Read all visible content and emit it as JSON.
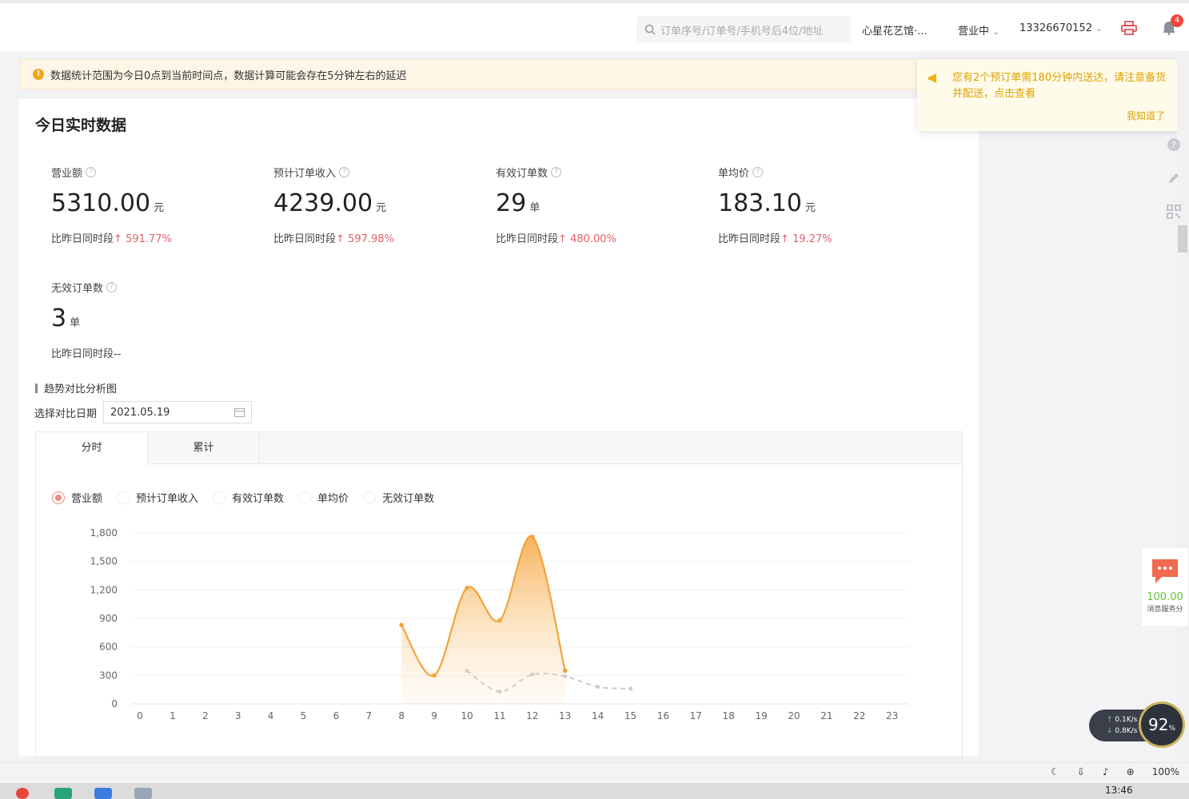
{
  "topbar": {
    "search_placeholder": "订单序号/订单号/手机号后4位/地址",
    "store_name": "心星花艺馆·...",
    "business_status": "营业中",
    "account": "13326670152",
    "notification_count": "4"
  },
  "notice": {
    "text": "数据统计范围为今日0点到当前时间点，数据计算可能会存在5分钟左右的延迟"
  },
  "popup": {
    "message": "您有2个预订单需180分钟内送达，请注意备货并配送，点击查看",
    "ok_label": "我知道了"
  },
  "realtime": {
    "title": "今日实时数据",
    "metrics": [
      {
        "label": "营业额",
        "value": "5310.00",
        "unit": "元",
        "compare_prefix": "比昨日同时段",
        "compare_arrow": "↑",
        "compare_value": "591.77%"
      },
      {
        "label": "预计订单收入",
        "value": "4239.00",
        "unit": "元",
        "compare_prefix": "比昨日同时段",
        "compare_arrow": "↑",
        "compare_value": "597.98%"
      },
      {
        "label": "有效订单数",
        "value": "29",
        "unit": "单",
        "compare_prefix": "比昨日同时段",
        "compare_arrow": "↑",
        "compare_value": "480.00%"
      },
      {
        "label": "单均价",
        "value": "183.10",
        "unit": "元",
        "compare_prefix": "比昨日同时段",
        "compare_arrow": "↑",
        "compare_value": "19.27%"
      },
      {
        "label": "无效订单数",
        "value": "3",
        "unit": "单",
        "compare_prefix": "比昨日同时段--",
        "compare_arrow": "",
        "compare_value": ""
      }
    ]
  },
  "trend": {
    "section_title": "趋势对比分析图",
    "date_label": "选择对比日期",
    "date_value": "2021.05.19",
    "tabs": [
      "分时",
      "累计"
    ],
    "radio_options": [
      "营业额",
      "预计订单收入",
      "有效订单数",
      "单均价",
      "无效订单数"
    ],
    "selected_radio": "营业额"
  },
  "chart_data": {
    "type": "area",
    "x": [
      0,
      1,
      2,
      3,
      4,
      5,
      6,
      7,
      8,
      9,
      10,
      11,
      12,
      13,
      14,
      15,
      16,
      17,
      18,
      19,
      20,
      21,
      22,
      23
    ],
    "ylim": [
      0,
      1800
    ],
    "y_ticks": [
      "0",
      "300",
      "600",
      "900",
      "1,200",
      "1,500",
      "1,800"
    ],
    "grid": true,
    "series": [
      {
        "hours": [
          8,
          9,
          10,
          11,
          12,
          13
        ],
        "values": [
          830,
          300,
          1220,
          880,
          1760,
          350
        ],
        "color": "#f2a33a"
      },
      {
        "hours": [
          10,
          11,
          12,
          13,
          14,
          15
        ],
        "values": [
          350,
          130,
          310,
          290,
          180,
          160
        ],
        "color": "#c8c8d0"
      }
    ]
  },
  "right_widgets": {
    "chat_score": "100.00",
    "chat_label": "消息服务分"
  },
  "net_speed": {
    "up": "0.1K/s",
    "down": "0.8K/s",
    "percent": "92"
  },
  "statusbar": {
    "zoom": "100%"
  },
  "taskbar": {
    "time": "13:46"
  }
}
